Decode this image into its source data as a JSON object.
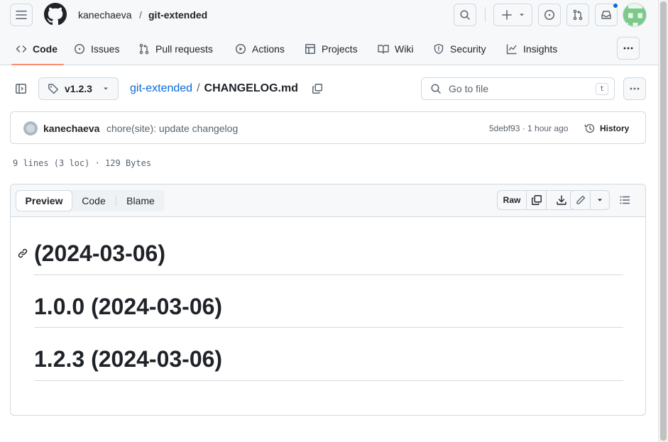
{
  "header": {
    "owner": "kanechaeva",
    "separator": "/",
    "repo": "git-extended"
  },
  "tabs": [
    {
      "label": "Code",
      "icon": "code-icon",
      "active": true
    },
    {
      "label": "Issues",
      "icon": "issue-opened-icon"
    },
    {
      "label": "Pull requests",
      "icon": "git-pull-request-icon"
    },
    {
      "label": "Actions",
      "icon": "play-icon"
    },
    {
      "label": "Projects",
      "icon": "table-icon"
    },
    {
      "label": "Wiki",
      "icon": "book-icon"
    },
    {
      "label": "Security",
      "icon": "shield-icon"
    },
    {
      "label": "Insights",
      "icon": "graph-icon"
    }
  ],
  "file_nav": {
    "branch": "v1.2.3",
    "repo_link": "git-extended",
    "path_sep": "/",
    "file_name": "CHANGELOG.md",
    "goto_placeholder": "Go to file",
    "goto_shortcut": "t"
  },
  "commit": {
    "author": "kanechaeva",
    "message": "chore(site): update changelog",
    "meta": "5debf93 · 1 hour ago",
    "history_label": "History"
  },
  "file_info": "9 lines (3 loc) · 129 Bytes",
  "viewer": {
    "modes": [
      "Preview",
      "Code",
      "Blame"
    ],
    "active_mode": "Preview",
    "raw_label": "Raw"
  },
  "markdown": {
    "headings": [
      "(2024-03-06)",
      "1.0.0 (2024-03-06)",
      "1.2.3 (2024-03-06)"
    ]
  },
  "colors": {
    "link": "#0969da",
    "tab_underline": "#fd8c73",
    "notification_dot": "#0969da",
    "avatar_green": "#8fd49a"
  }
}
